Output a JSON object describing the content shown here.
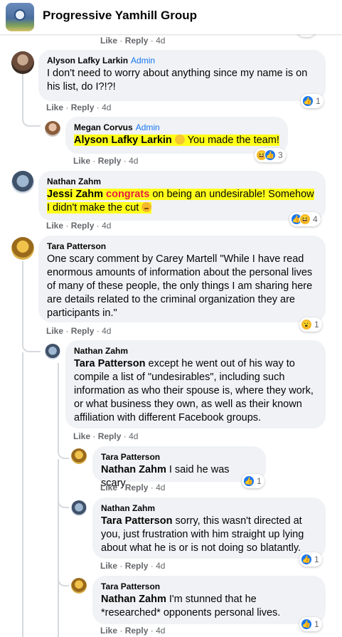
{
  "group": {
    "title": "Progressive Yamhill Group"
  },
  "meta": {
    "like": "Like",
    "reply": "Reply",
    "sep": "·"
  },
  "comments": [
    {
      "id": "top-partial",
      "time": "4d"
    },
    {
      "id": "alyson",
      "author": "Alyson Lafky Larkin",
      "badge": "Admin",
      "text": "I don't need to worry about anything since my name is on his list, do I?!?!",
      "time": "4d",
      "reactions": "1"
    },
    {
      "id": "megan",
      "author": "Megan Corvus",
      "badge": "Admin",
      "mention": "Alyson Lafky Larkin",
      "text": "You made the team!",
      "time": "4d",
      "reactions": "3"
    },
    {
      "id": "nathan1",
      "author": "Nathan Zahm",
      "mention": "Jessi Zahm",
      "highlight_word": "congrats",
      "text": "on being an undesirable! Somehow I didn't make the cut",
      "time": "4d",
      "reactions": "4"
    },
    {
      "id": "tara1",
      "author": "Tara Patterson",
      "text": "One scary comment by Carey Martell \"While I have read enormous amounts of information about the personal lives of many of these people, the only things I am sharing here are details related to the criminal organization they are participants in.\"",
      "time": "4d",
      "reactions": "1"
    },
    {
      "id": "nathan2",
      "author": "Nathan Zahm",
      "mention": "Tara Patterson",
      "text": "except he went out of his way to compile a list of \"undesirables\", including such information as who their spouse is, where they work, or what business they own, as well as their known affiliation with different Facebook groups.",
      "time": "4d"
    },
    {
      "id": "tara2",
      "author": "Tara Patterson",
      "mention": "Nathan Zahm",
      "text": "I said he was scary.",
      "time": "4d",
      "reactions": "1"
    },
    {
      "id": "nathan3",
      "author": "Nathan Zahm",
      "mention": "Tara Patterson",
      "text": "sorry, this wasn't directed at you, just frustration with him straight up lying about what he is or is not doing so blatantly.",
      "time": "4d",
      "reactions": "1"
    },
    {
      "id": "tara3",
      "author": "Tara Patterson",
      "mention": "Nathan Zahm",
      "text": "I'm stunned that he *researched* opponents personal lives.",
      "time": "4d",
      "reactions": "1"
    }
  ],
  "icons": {
    "like": "thumbs-up-icon",
    "haha": "laughing-face-icon",
    "wow": "surprised-face-icon"
  },
  "colors": {
    "link_blue": "#1877f2",
    "bubble": "#f0f2f5",
    "meta_gray": "#65676b",
    "highlight": "#ffff1a",
    "congrats_red": "#e41e3f"
  }
}
